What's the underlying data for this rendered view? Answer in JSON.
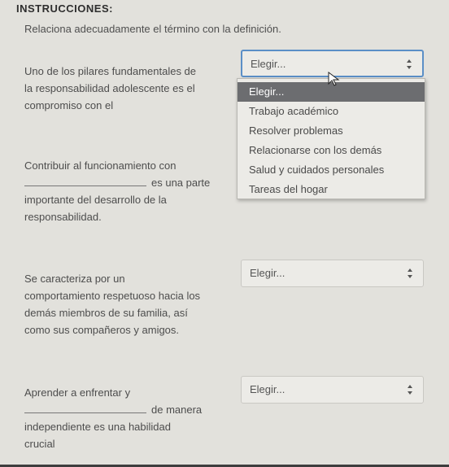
{
  "header": {
    "title": "INSTRUCCIONES:",
    "subtitle": "Relaciona adecuadamente el término con la definición."
  },
  "questions": [
    {
      "lines": [
        "Uno de los pilares fundamentales de",
        "la responsabilidad adolescente es el",
        "compromiso con el"
      ],
      "select_value": "Elegir..."
    },
    {
      "lines": [
        "Contribuir al funcionamiento con",
        "es una parte",
        "importante del desarrollo de la",
        "responsabilidad."
      ],
      "select_value": "Elegir..."
    },
    {
      "lines": [
        "Se caracteriza por un",
        "comportamiento respetuoso hacia los",
        "demás miembros de su familia, así",
        "como sus compañeros y amigos."
      ],
      "select_value": "Elegir..."
    },
    {
      "lines": [
        "Aprender a enfrentar y",
        "de manera",
        "independiente es una habilidad",
        "crucial"
      ],
      "select_value": "Elegir..."
    }
  ],
  "dropdown": {
    "options": [
      "Elegir...",
      "Trabajo académico",
      "Resolver problemas",
      "Relacionarse con los demás",
      "Salud y cuidados personales",
      "Tareas del hogar"
    ],
    "selected_index": 0
  },
  "icons": {
    "select_arrows": "updown-arrows-icon",
    "cursor": "mouse-pointer-icon"
  },
  "colors": {
    "highlight": "#6c6d70",
    "focus_border": "#5b8fc7",
    "background": "#e2e1dc"
  }
}
